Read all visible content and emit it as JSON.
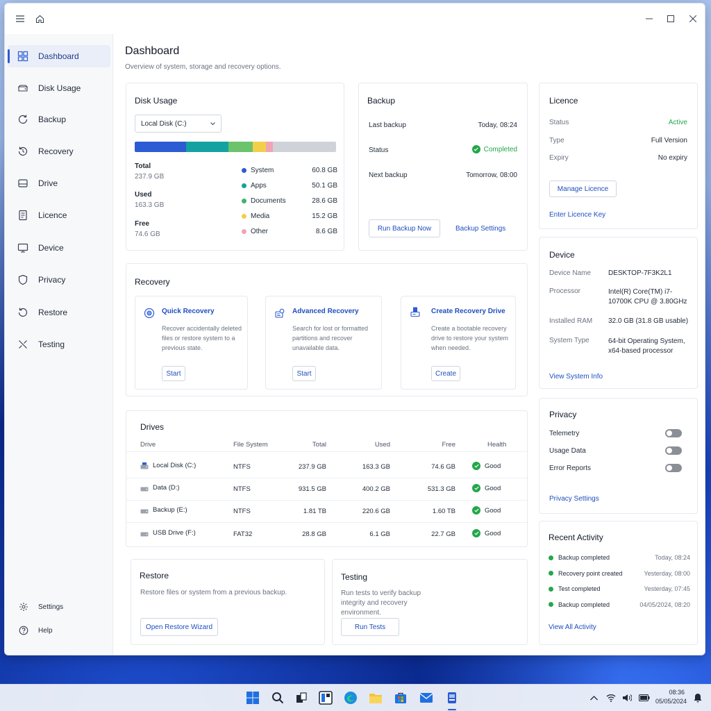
{
  "colors": {
    "accent": "#2d5bd3",
    "system": "#2d5bd3",
    "apps": "#14a2a0",
    "documents": "#6cc36b",
    "media": "#f2cf4b",
    "other": "#f1a4b2",
    "free": "#cfd3d9",
    "good": "#22a74a"
  },
  "sidebar": {
    "items": [
      {
        "label": "Dashboard",
        "icon": "dashboard-icon"
      },
      {
        "label": "Disk Usage",
        "icon": "disk-icon"
      },
      {
        "label": "Backup",
        "icon": "backup-icon"
      },
      {
        "label": "Recovery",
        "icon": "recovery-icon"
      },
      {
        "label": "Drive",
        "icon": "drive-icon"
      },
      {
        "label": "Licence",
        "icon": "licence-icon"
      },
      {
        "label": "Device",
        "icon": "device-icon"
      },
      {
        "label": "Privacy",
        "icon": "shield-icon"
      },
      {
        "label": "Restore",
        "icon": "restore-icon"
      },
      {
        "label": "Testing",
        "icon": "tools-icon"
      }
    ],
    "settings_label": "Settings",
    "help_label": "Help"
  },
  "header": {
    "title": "Dashboard",
    "subtitle": "Overview of system, storage and recovery options."
  },
  "disk_usage": {
    "title": "Disk Usage",
    "selected_disk": "Local Disk (C:)",
    "bar": [
      {
        "key": "system",
        "value": 60.8
      },
      {
        "key": "apps",
        "value": 50.1
      },
      {
        "key": "documents",
        "value": 28.6
      },
      {
        "key": "media",
        "value": 15.2
      },
      {
        "key": "other",
        "value": 8.6
      },
      {
        "key": "free",
        "value": 74.6
      }
    ],
    "stats": [
      {
        "label": "Total",
        "value": "237.9 GB"
      },
      {
        "label": "Used",
        "value": "163.3 GB"
      },
      {
        "label": "Free",
        "value": "74.6 GB"
      }
    ],
    "legend": [
      {
        "name": "System",
        "value": "60.8 GB",
        "color": "#2d5bd3"
      },
      {
        "name": "Apps",
        "value": "50.1 GB",
        "color": "#14a2a0"
      },
      {
        "name": "Documents",
        "value": "28.6 GB",
        "color": "#3fb36a"
      },
      {
        "name": "Media",
        "value": "15.2 GB",
        "color": "#f2cf4b"
      },
      {
        "name": "Other",
        "value": "8.6 GB",
        "color": "#f1a4b2"
      }
    ]
  },
  "backup": {
    "title": "Backup",
    "last_label": "Last backup",
    "last_value": "Today, 08:24",
    "status_label": "Status",
    "status_value": "Completed",
    "next_label": "Next backup",
    "next_value": "Tomorrow, 08:00",
    "run_label": "Run Backup Now",
    "settings_label": "Backup Settings"
  },
  "licence": {
    "title": "Licence",
    "status_label": "Status",
    "status_value": "Active",
    "type_label": "Type",
    "type_value": "Full Version",
    "expiry_label": "Expiry",
    "expiry_value": "No expiry",
    "manage_label": "Manage Licence",
    "enter_label": "Enter Licence Key"
  },
  "recovery": {
    "title": "Recovery",
    "options": [
      {
        "title": "Quick Recovery",
        "desc": "Recover accidentally deleted files or restore system to a previous state.",
        "button": "Start"
      },
      {
        "title": "Advanced Recovery",
        "desc": "Search for lost or formatted partitions and recover unavailable data.",
        "button": "Start"
      },
      {
        "title": "Create Recovery Drive",
        "desc": "Create a bootable recovery drive to restore your system when needed.",
        "button": "Create"
      }
    ]
  },
  "device": {
    "title": "Device",
    "name_label": "Device Name",
    "name_value": "DESKTOP-7F3K2L1",
    "proc_label": "Processor",
    "proc_value": "Intel(R) Core(TM) i7-10700K CPU @ 3.80GHz",
    "ram_label": "Installed RAM",
    "ram_value": "32.0 GB (31.8 GB usable)",
    "type_label": "System Type",
    "type_value": "64-bit Operating System, x64-based processor",
    "link": "View System Info"
  },
  "drives": {
    "title": "Drives",
    "columns": [
      "Drive",
      "File System",
      "Total",
      "Used",
      "Free",
      "Health"
    ],
    "rows": [
      {
        "name": "Local Disk (C:)",
        "fs": "NTFS",
        "total": "237.9 GB",
        "used": "163.3 GB",
        "free": "74.6 GB",
        "health": "Good"
      },
      {
        "name": "Data (D:)",
        "fs": "NTFS",
        "total": "931.5 GB",
        "used": "400.2 GB",
        "free": "531.3 GB",
        "health": "Good"
      },
      {
        "name": "Backup (E:)",
        "fs": "NTFS",
        "total": "1.81 TB",
        "used": "220.6 GB",
        "free": "1.60 TB",
        "health": "Good"
      },
      {
        "name": "USB Drive (F:)",
        "fs": "FAT32",
        "total": "28.8 GB",
        "used": "6.1 GB",
        "free": "22.7 GB",
        "health": "Good"
      }
    ]
  },
  "privacy": {
    "title": "Privacy",
    "toggles": [
      {
        "label": "Telemetry",
        "on": false
      },
      {
        "label": "Usage Data",
        "on": false
      },
      {
        "label": "Error Reports",
        "on": false
      }
    ],
    "link": "Privacy Settings"
  },
  "restore": {
    "title": "Restore",
    "desc": "Restore files or system from a previous backup.",
    "button": "Open Restore Wizard"
  },
  "testing": {
    "title": "Testing",
    "desc": "Run tests to verify backup integrity and recovery environment.",
    "button": "Run Tests"
  },
  "activity": {
    "title": "Recent Activity",
    "items": [
      {
        "label": "Backup completed",
        "time": "Today, 08:24"
      },
      {
        "label": "Recovery point created",
        "time": "Yesterday, 08:00"
      },
      {
        "label": "Test completed",
        "time": "Yesterday, 07:45"
      },
      {
        "label": "Backup completed",
        "time": "04/05/2024, 08:20"
      }
    ],
    "link": "View All Activity"
  },
  "taskbar": {
    "time": "08:36",
    "date": "05/05/2024"
  }
}
